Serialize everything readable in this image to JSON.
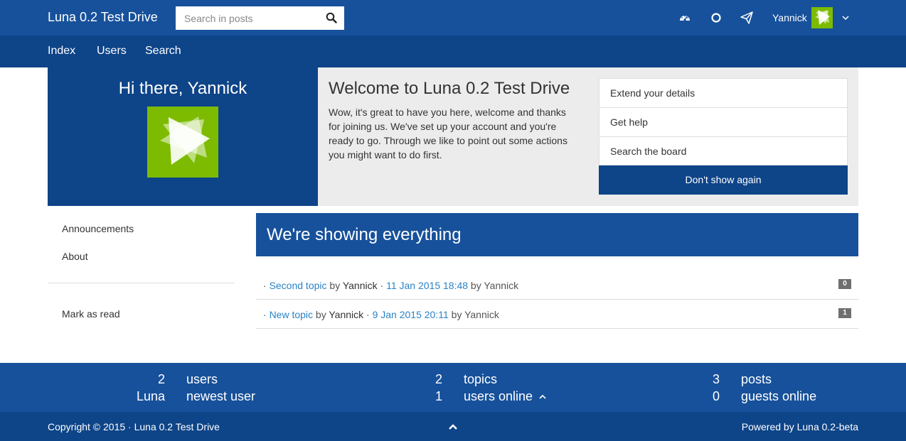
{
  "header": {
    "brand": "Luna 0.2 Test Drive",
    "search_placeholder": "Search in posts",
    "search_icon": "search-icon",
    "icons": [
      "dashboard-icon",
      "notification-circle-icon",
      "paper-plane-icon"
    ],
    "username": "Yannick",
    "avatar_color": "#7cbb00",
    "dropdown_icon": "chevron-down-icon"
  },
  "nav": {
    "items": [
      {
        "label": "Index"
      },
      {
        "label": "Users"
      },
      {
        "label": "Search"
      }
    ]
  },
  "welcome": {
    "greeting": "Hi there, Yannick",
    "title": "Welcome to Luna 0.2 Test Drive",
    "message": "Wow, it's great to have you here, welcome and thanks for joining us. We've set up your account and you're ready to go. Through we like to point out some actions you might want to do first.",
    "actions": [
      {
        "label": "Extend your details"
      },
      {
        "label": "Get help"
      },
      {
        "label": "Search the board"
      }
    ],
    "dismiss_label": "Don't show again"
  },
  "sidebar": {
    "items": [
      {
        "label": "Announcements"
      },
      {
        "label": "About"
      }
    ],
    "mark_read_label": "Mark as read"
  },
  "main": {
    "title": "We're showing everything",
    "topics": [
      {
        "title": "Second topic",
        "by_text": "by",
        "author": "Yannick",
        "last_post": "11 Jan 2015 18:48",
        "last_by_text": "by",
        "last_author": "Yannick",
        "replies": "0"
      },
      {
        "title": "New topic",
        "by_text": "by",
        "author": "Yannick",
        "last_post": "9 Jan 2015 20:11",
        "last_by_text": "by",
        "last_author": "Yannick",
        "replies": "1"
      }
    ]
  },
  "stats": {
    "users_count": "2",
    "users_label": "users",
    "newest_user": "Luna",
    "newest_user_label": "newest user",
    "topics_count": "2",
    "topics_label": "topics",
    "online_count": "1",
    "online_label": "users online",
    "posts_count": "3",
    "posts_label": "posts",
    "guests_count": "0",
    "guests_label": "guests online"
  },
  "footer": {
    "copyright": "Copyright © 2015 · Luna 0.2 Test Drive",
    "powered": "Powered by Luna 0.2-beta"
  },
  "colors": {
    "primary": "#17519b",
    "primary_dark": "#0e4488",
    "link": "#2a83c6",
    "avatar": "#7cbb00",
    "panel_gray": "#ececec"
  }
}
